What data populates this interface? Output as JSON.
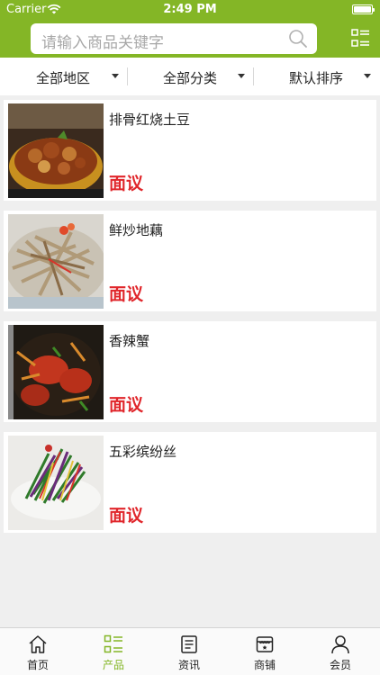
{
  "status_bar": {
    "carrier": "Carrier",
    "time": "2:49 PM"
  },
  "header": {
    "search_placeholder": "请输入商品关键字",
    "search_icon": "search-icon",
    "menu_icon": "list-menu-icon"
  },
  "filters": [
    {
      "label": "全部地区"
    },
    {
      "label": "全部分类"
    },
    {
      "label": "默认排序"
    }
  ],
  "products": [
    {
      "name": "排骨红烧土豆",
      "price": "面议"
    },
    {
      "name": "鲜炒地藕",
      "price": "面议"
    },
    {
      "name": "香辣蟹",
      "price": "面议"
    },
    {
      "name": "五彩缤纷丝",
      "price": "面议"
    }
  ],
  "tabs": [
    {
      "label": "首页",
      "icon": "home-icon"
    },
    {
      "label": "产品",
      "icon": "product-list-icon"
    },
    {
      "label": "资讯",
      "icon": "news-icon"
    },
    {
      "label": "商铺",
      "icon": "shop-icon"
    },
    {
      "label": "会员",
      "icon": "user-icon"
    }
  ],
  "colors": {
    "brand": "#84b626",
    "price": "#e0262b",
    "background": "#efefef"
  },
  "active_tab": 1
}
